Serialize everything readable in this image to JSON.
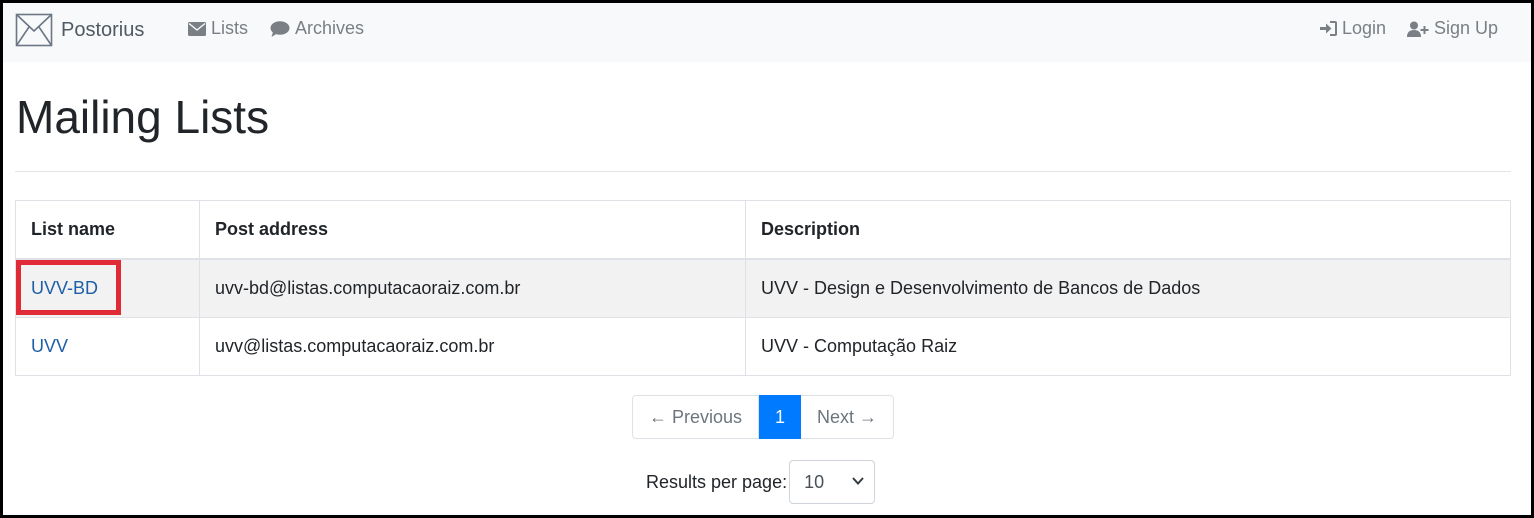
{
  "navbar": {
    "brand": "Postorius",
    "lists": "Lists",
    "archives": "Archives",
    "login": "Login",
    "signup": "Sign Up"
  },
  "page": {
    "title": "Mailing Lists"
  },
  "table": {
    "headers": [
      "List name",
      "Post address",
      "Description"
    ],
    "rows": [
      {
        "name": "UVV-BD",
        "address": "uvv-bd@listas.computacaoraiz.com.br",
        "description": "UVV - Design e Desenvolvimento de Bancos de Dados"
      },
      {
        "name": "UVV",
        "address": "uvv@listas.computacaoraiz.com.br",
        "description": "UVV - Computação Raiz"
      }
    ]
  },
  "pagination": {
    "previous": "← Previous",
    "current": "1",
    "next": "Next →"
  },
  "per_page": {
    "label": "Results per page:",
    "value": "10"
  },
  "colors": {
    "link": "#1f5fa8",
    "active_page": "#007bff",
    "highlight": "#e02a36"
  },
  "icons": {
    "brand": "envelope-outline-icon",
    "lists": "envelope-icon",
    "archives": "comment-icon",
    "login": "sign-in-icon",
    "signup": "user-plus-icon",
    "select": "chevron-down-icon"
  }
}
